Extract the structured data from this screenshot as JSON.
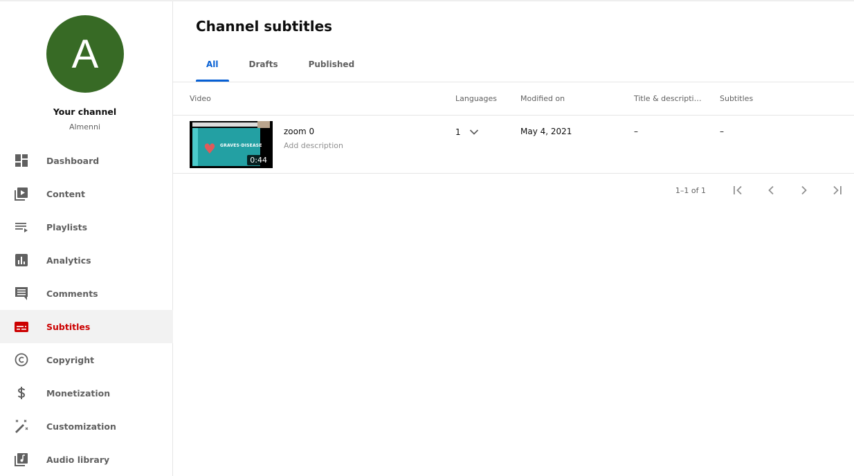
{
  "channel": {
    "avatar_letter": "A",
    "avatar_color": "#376a25",
    "title": "Your channel",
    "name": "Almenni"
  },
  "sidebar": {
    "items": [
      {
        "label": "Dashboard",
        "icon": "dashboard-icon"
      },
      {
        "label": "Content",
        "icon": "content-icon"
      },
      {
        "label": "Playlists",
        "icon": "playlists-icon"
      },
      {
        "label": "Analytics",
        "icon": "analytics-icon"
      },
      {
        "label": "Comments",
        "icon": "comments-icon"
      },
      {
        "label": "Subtitles",
        "icon": "subtitles-icon",
        "active": true
      },
      {
        "label": "Copyright",
        "icon": "copyright-icon"
      },
      {
        "label": "Monetization",
        "icon": "dollar-icon"
      },
      {
        "label": "Customization",
        "icon": "magic-wand-icon"
      },
      {
        "label": "Audio library",
        "icon": "audio-library-icon"
      }
    ],
    "active_color": "#cc0000"
  },
  "page": {
    "title": "Channel subtitles",
    "tabs": [
      {
        "label": "All",
        "active": true
      },
      {
        "label": "Drafts"
      },
      {
        "label": "Published"
      }
    ],
    "accent_color": "#065fd4"
  },
  "table": {
    "columns": [
      "Video",
      "Languages",
      "Modified on",
      "Title & descripti…",
      "Subtitles"
    ],
    "rows": [
      {
        "thumbnail_text": "GRAVES·DISEASE",
        "duration": "0:44",
        "title": "zoom 0",
        "description": "Add description",
        "languages": "1",
        "modified_on": "May 4, 2021",
        "title_description": "–",
        "subtitles": "–"
      }
    ]
  },
  "pagination": {
    "range_text": "1–1 of 1"
  }
}
